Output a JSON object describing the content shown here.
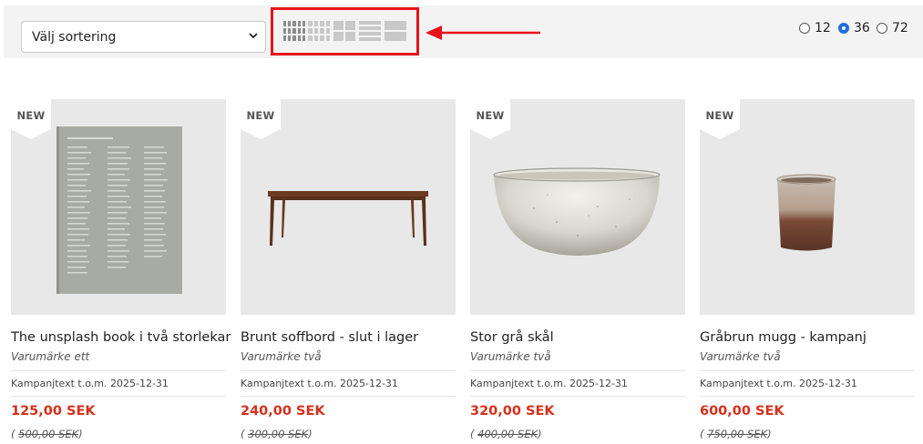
{
  "toolbar": {
    "sort_select": "Välj sortering",
    "per_page": [
      {
        "value": "12",
        "checked": false
      },
      {
        "value": "36",
        "checked": true
      },
      {
        "value": "72",
        "checked": false
      }
    ]
  },
  "highlight_color": "#e8121b",
  "price_color": "#d5301c",
  "products": [
    {
      "badge": "NEW",
      "name": "The unsplash book i två storlekar",
      "brand": "Varumärke ett",
      "campaign": "Kampanjtext t.o.m. 2025-12-31",
      "price": "125,00 SEK",
      "old_price": "500,00 SEK"
    },
    {
      "badge": "NEW",
      "name": "Brunt soffbord - slut i lager",
      "brand": "Varumärke två",
      "campaign": "Kampanjtext t.o.m. 2025-12-31",
      "price": "240,00 SEK",
      "old_price": "300,00 SEK"
    },
    {
      "badge": "NEW",
      "name": "Stor grå skål",
      "brand": "Varumärke två",
      "campaign": "Kampanjtext t.o.m. 2025-12-31",
      "price": "320,00 SEK",
      "old_price": "400,00 SEK"
    },
    {
      "badge": "NEW",
      "name": "Gråbrun mugg - kampanj",
      "brand": "Varumärke två",
      "campaign": "Kampanjtext t.o.m. 2025-12-31",
      "price": "600,00 SEK",
      "old_price": "750,00 SEK"
    }
  ]
}
